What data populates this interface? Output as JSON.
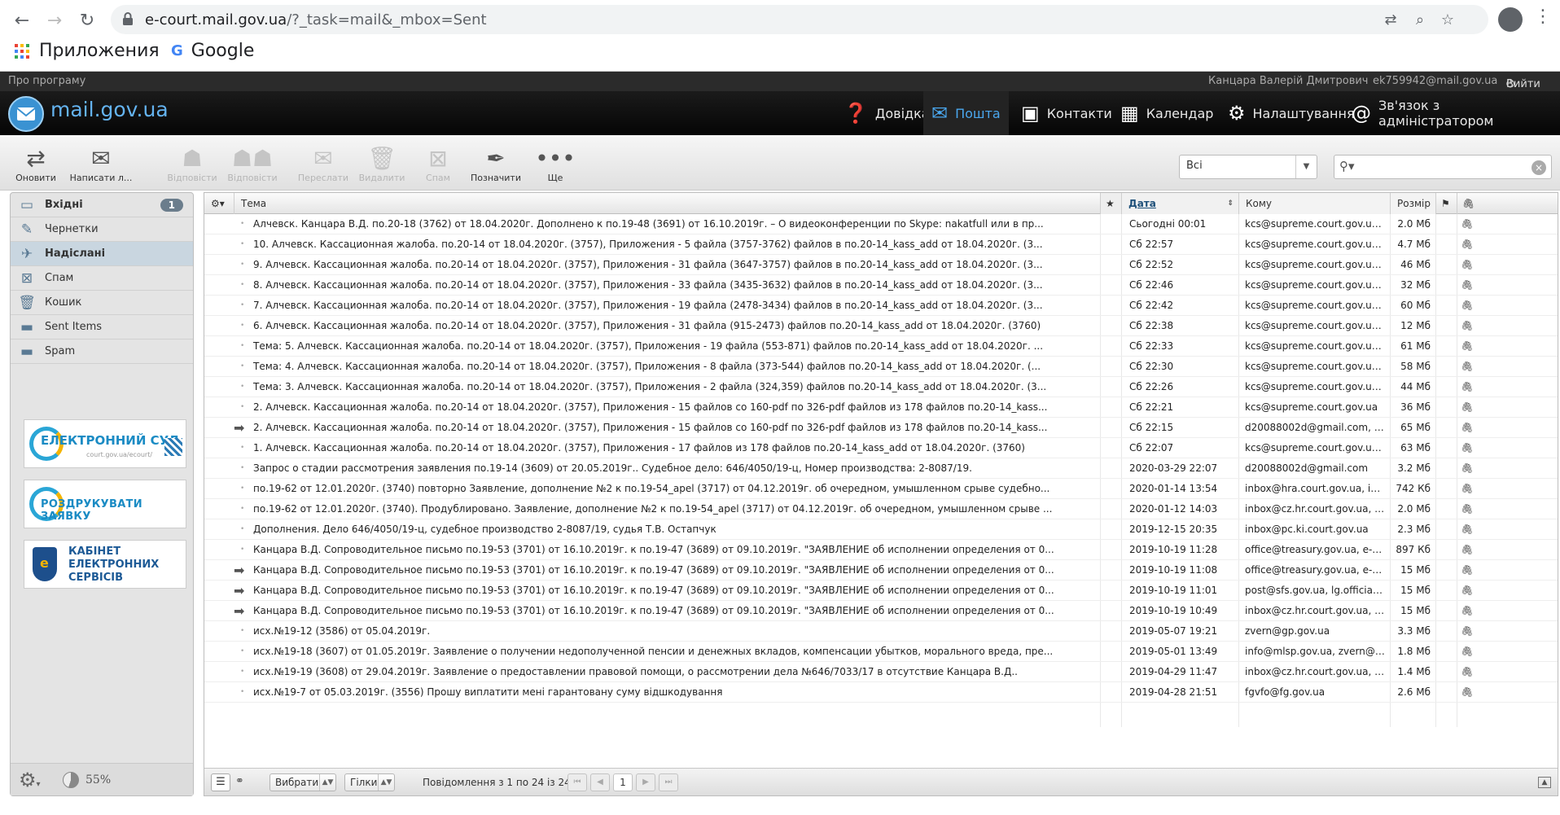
{
  "browser": {
    "url_host": "e-court.mail.gov.ua",
    "url_path": "/?_task=mail&_mbox=Sent",
    "bookmarks": {
      "apps": "Приложения",
      "google": "Google"
    }
  },
  "topbar": {
    "about": "Про програму",
    "user_name": "Канцара Валерій Дмитрович",
    "user_email": "ek759942@mail.gov.ua",
    "logout": "Вийти"
  },
  "header": {
    "logo": "mail.gov.ua",
    "nav": [
      {
        "label": "Довідка",
        "icon": "help-icon"
      },
      {
        "label": "Пошта",
        "icon": "mail-icon",
        "active": true
      },
      {
        "label": "Контакти",
        "icon": "contacts-icon"
      },
      {
        "label": "Календар",
        "icon": "calendar-icon"
      },
      {
        "label": "Налаштування",
        "icon": "gear-icon"
      },
      {
        "label": "Зв'язок з адміністратором",
        "icon": "at-icon"
      }
    ]
  },
  "toolbar": {
    "buttons": [
      {
        "label": "Оновити",
        "enabled": true
      },
      {
        "label": "Написати л...",
        "enabled": true
      },
      {
        "label": "Відповісти",
        "enabled": false
      },
      {
        "label": "Відповісти",
        "enabled": false
      },
      {
        "label": "Переслати",
        "enabled": false
      },
      {
        "label": "Видалити",
        "enabled": false
      },
      {
        "label": "Спам",
        "enabled": false
      },
      {
        "label": "Позначити",
        "enabled": true
      },
      {
        "label": "Ще",
        "enabled": true
      }
    ],
    "filter_value": "Всі"
  },
  "folders": [
    {
      "label": "Вхідні",
      "count": "1",
      "bold": true
    },
    {
      "label": "Чернетки"
    },
    {
      "label": "Надіслані",
      "selected": true
    },
    {
      "label": "Спам"
    },
    {
      "label": "Кошик"
    },
    {
      "label": "Sent Items"
    },
    {
      "label": "Spam"
    }
  ],
  "banners": {
    "ecourt": "ЕЛЕКТРОННИЙ СУД",
    "ecourt_sub": "court.gov.ua/ecourt/",
    "print": "РОЗДРУКУВАТИ ЗАЯВКУ",
    "cabinet": [
      "КАБІНЕТ",
      "ЕЛЕКТРОННИХ",
      "СЕРВІСІВ"
    ]
  },
  "quota": "55%",
  "columns": {
    "subject": "Тема",
    "date": "Дата",
    "to": "Кому",
    "size": "Розмір"
  },
  "messages": [
    {
      "subject": "Алчевск. Канцара В.Д. по.20-18 (3762) от 18.04.2020г. Дополнено к по.19-48 (3691) от 16.10.2019г. – О видеоконференции по Skype: nakatfull или в пр...",
      "date": "Сьогодні 00:01",
      "to": "kcs@supreme.court.gov.ua, inb...",
      "size": "2.0 Мб",
      "fwd": false
    },
    {
      "subject": "10. Алчевск. Кассационная жалоба. по.20-14 от 18.04.2020г. (3757), Приложения - 5 файла (3757-3762) файлов в по.20-14_kass_add от 18.04.2020г. (3...",
      "date": "Сб 22:57",
      "to": "kcs@supreme.court.gov.ua, d2...",
      "size": "4.7 Мб",
      "fwd": false
    },
    {
      "subject": "9. Алчевск. Кассационная жалоба. по.20-14 от 18.04.2020г. (3757), Приложения - 31 файла (3647-3757) файлов в по.20-14_kass_add от 18.04.2020г. (3...",
      "date": "Сб 22:52",
      "to": "kcs@supreme.court.gov.ua, d2...",
      "size": "46 Мб",
      "fwd": false
    },
    {
      "subject": "8. Алчевск. Кассационная жалоба. по.20-14 от 18.04.2020г. (3757), Приложения - 33 файла (3435-3632) файлов в по.20-14_kass_add от 18.04.2020г. (3...",
      "date": "Сб 22:46",
      "to": "kcs@supreme.court.gov.ua, d2...",
      "size": "32 Мб",
      "fwd": false
    },
    {
      "subject": "7. Алчевск. Кассационная жалоба. по.20-14 от 18.04.2020г. (3757), Приложения - 19 файла (2478-3434) файлов в по.20-14_kass_add от 18.04.2020г. (3...",
      "date": "Сб 22:42",
      "to": "kcs@supreme.court.gov.ua, d2...",
      "size": "60 Мб",
      "fwd": false
    },
    {
      "subject": "6. Алчевск. Кассационная жалоба. по.20-14 от 18.04.2020г. (3757), Приложения - 31 файла (915-2473) файлов по.20-14_kass_add от 18.04.2020г. (3760)",
      "date": "Сб 22:38",
      "to": "kcs@supreme.court.gov.ua, d2...",
      "size": "12 Мб",
      "fwd": false
    },
    {
      "subject": "Тема: 5. Алчевск. Кассационная жалоба. по.20-14 от 18.04.2020г. (3757), Приложения - 19 файла (553-871) файлов по.20-14_kass_add от 18.04.2020г. ...",
      "date": "Сб 22:33",
      "to": "kcs@supreme.court.gov.ua, d2...",
      "size": "61 Мб",
      "fwd": false
    },
    {
      "subject": "Тема: 4. Алчевск. Кассационная жалоба. по.20-14 от 18.04.2020г. (3757), Приложения - 8 файла (373-544) файлов по.20-14_kass_add от 18.04.2020г. (...",
      "date": "Сб 22:30",
      "to": "kcs@supreme.court.gov.ua, d2...",
      "size": "58 Мб",
      "fwd": false
    },
    {
      "subject": "Тема: 3. Алчевск. Кассационная жалоба. по.20-14 от 18.04.2020г. (3757), Приложения - 2 файла (324,359) файлов по.20-14_kass_add от 18.04.2020г. (3...",
      "date": "Сб 22:26",
      "to": "kcs@supreme.court.gov.ua, d2...",
      "size": "44 Мб",
      "fwd": false
    },
    {
      "subject": "2. Алчевск. Кассационная жалоба. по.20-14 от 18.04.2020г. (3757), Приложения - 15 файлов со 160-pdf по 326-pdf файлов из 178 файлов по.20-14_kass...",
      "date": "Сб 22:21",
      "to": "kcs@supreme.court.gov.ua",
      "size": "36 Мб",
      "fwd": false
    },
    {
      "subject": "2. Алчевск. Кассационная жалоба. по.20-14 от 18.04.2020г. (3757), Приложения - 15 файлов со 160-pdf по 326-pdf файлов из 178 файлов по.20-14_kass...",
      "date": "Сб 22:15",
      "to": "d20088002d@gmail.com, ek75...",
      "size": "65 Мб",
      "fwd": true
    },
    {
      "subject": "1. Алчевск. Кассационная жалоба. по.20-14 от 18.04.2020г. (3757), Приложения - 17 файлов из 178 файлов по.20-14_kass_add от 18.04.2020г. (3760)",
      "date": "Сб 22:07",
      "to": "kcs@supreme.court.gov.ua, d2...",
      "size": "63 Мб",
      "fwd": false
    },
    {
      "subject": "Запрос о стадии рассмотрения заявления по.19-14 (3609) от 20.05.2019г.. Судебное дело: 646/4050/19-ц, Номер производства: 2-8087/19.",
      "date": "2020-03-29 22:07",
      "to": "d20088002d@gmail.com",
      "size": "3.2 Мб",
      "fwd": false
    },
    {
      "subject": "по.19-62 от 12.01.2020г. (3740) повторно Заявление, дополнение №2 к по.19-54_apel (3717) от 04.12.2019г. об очередном, умышленном срыве судебно...",
      "date": "2020-01-14 13:54",
      "to": "inbox@hra.court.gov.ua, inbox...",
      "size": "742 Кб",
      "fwd": false
    },
    {
      "subject": "по.19-62 от 12.01.2020г. (3740). Продублировано. Заявление, дополнение №2 к по.19-54_apel (3717) от 04.12.2019г. об очередном, умышленном срыве ...",
      "date": "2020-01-12 14:03",
      "to": "inbox@cz.hr.court.gov.ua, inbox...",
      "size": "2.0 Мб",
      "fwd": false
    },
    {
      "subject": "Дополнения. Дело 646/4050/19-ц, судебное производство 2-8087/19, судья Т.В. Остапчук",
      "date": "2019-12-15 20:35",
      "to": "inbox@pc.ki.court.gov.ua",
      "size": "2.3 Мб",
      "fwd": false
    },
    {
      "subject": "Канцара В.Д. Сопроводительное письмо по.19-53 (3701) от 16.10.2019г. к по.19-47 (3689) от 09.10.2019г. \"ЗАЯВЛЕНИЕ об исполнении определения от 0...",
      "date": "2019-10-19 11:28",
      "to": "office@treasury.gov.ua, e-client...",
      "size": "897 Кб",
      "fwd": false
    },
    {
      "subject": "Канцара В.Д. Сопроводительное письмо по.19-53 (3701) от 16.10.2019г. к по.19-47 (3689) от 09.10.2019г. \"ЗАЯВЛЕНИЕ об исполнении определения от 0...",
      "date": "2019-10-19 11:08",
      "to": "office@treasury.gov.ua, e-client...",
      "size": "15 Мб",
      "fwd": true
    },
    {
      "subject": "Канцара В.Д. Сопроводительное письмо по.19-53 (3701) от 16.10.2019г. к по.19-47 (3689) от 09.10.2019г. \"ЗАЯВЛЕНИЕ об исполнении определения от 0...",
      "date": "2019-10-19 11:01",
      "to": "post@sfs.gov.ua, lg.official@sfs...",
      "size": "15 Мб",
      "fwd": true
    },
    {
      "subject": "Канцара В.Д. Сопроводительное письмо по.19-53 (3701) от 16.10.2019г. к по.19-47 (3689) от 09.10.2019г. \"ЗАЯВЛЕНИЕ об исполнении определения от 0...",
      "date": "2019-10-19 10:49",
      "to": "inbox@cz.hr.court.gov.ua, ops@...",
      "size": "15 Мб",
      "fwd": true
    },
    {
      "subject": "исх.№19-12 (3586) от 05.04.2019г.",
      "date": "2019-05-07 19:21",
      "to": "zvern@gp.gov.ua",
      "size": "3.3 Мб",
      "fwd": false
    },
    {
      "subject": "исх.№19-18 (3607) от 01.05.2019г. Заявление о получении недополученной пенсии и денежных вкладов, компенсации убытков, морального вреда, пре...",
      "date": "2019-05-01 13:49",
      "to": "info@mlsp.gov.ua, zvern@gp.g...",
      "size": "1.8 Мб",
      "fwd": false
    },
    {
      "subject": "исх.№19-19 (3608) от 29.04.2019г. Заявление о предоставлении правовой помощи, о рассмотрении дела №646/7033/17 в отсутствие Канцара В.Д..",
      "date": "2019-04-29 11:47",
      "to": "inbox@cz.hr.court.gov.ua, zvern...",
      "size": "1.4 Мб",
      "fwd": false
    },
    {
      "subject": "исх.№19-7 от 05.03.2019г. (3556) Прошу виплатити мені гарантовану суму відшкодування",
      "date": "2019-04-28 21:51",
      "to": "fgvfo@fg.gov.ua",
      "size": "2.6 Мб",
      "fwd": false
    }
  ],
  "footer": {
    "select_label": "Вибрати",
    "threads_label": "Гілки",
    "count_text": "Повідомлення з 1 по 24 із 24",
    "page": "1"
  }
}
